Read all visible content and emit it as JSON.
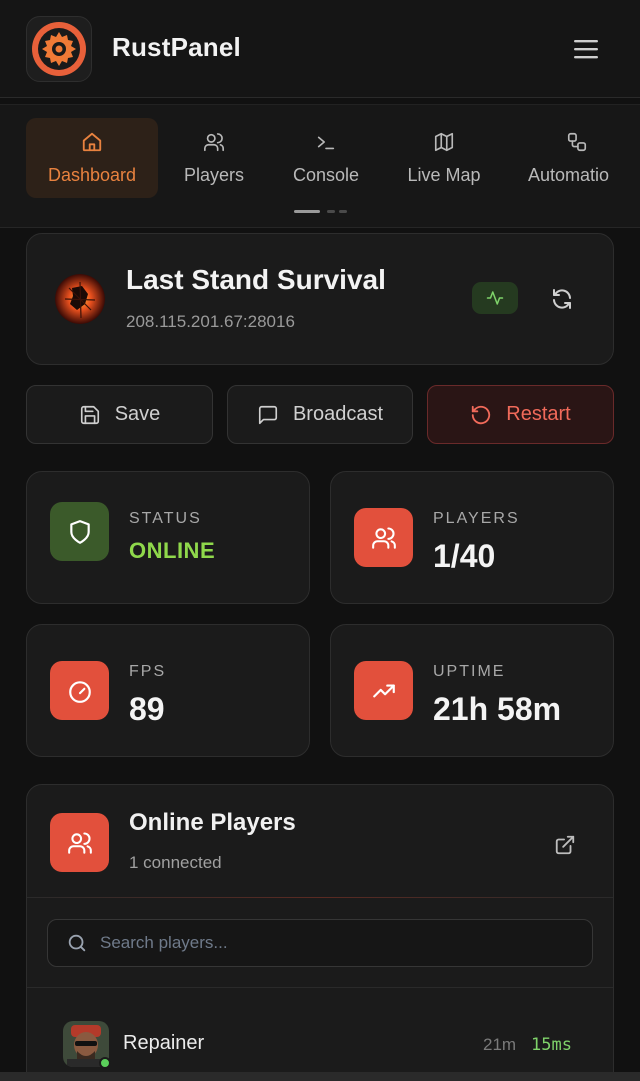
{
  "app": {
    "title": "RustPanel"
  },
  "nav": {
    "tabs": [
      {
        "label": "Dashboard",
        "icon": "home-icon",
        "active": true
      },
      {
        "label": "Players",
        "icon": "users-icon",
        "active": false
      },
      {
        "label": "Console",
        "icon": "terminal-icon",
        "active": false
      },
      {
        "label": "Live Map",
        "icon": "map-icon",
        "active": false
      },
      {
        "label": "Automatio",
        "icon": "workflow-icon",
        "active": false
      }
    ]
  },
  "server": {
    "name": "Last Stand Survival",
    "address": "208.115.201.67:28016"
  },
  "actions": {
    "save": "Save",
    "broadcast": "Broadcast",
    "restart": "Restart"
  },
  "stats": {
    "status": {
      "label": "STATUS",
      "value": "ONLINE"
    },
    "players": {
      "label": "PLAYERS",
      "value": "1/40"
    },
    "fps": {
      "label": "FPS",
      "value": "89"
    },
    "uptime": {
      "label": "UPTIME",
      "value": "21h 58m"
    }
  },
  "online_players": {
    "title": "Online Players",
    "subtitle": "1 connected",
    "search_placeholder": "Search players...",
    "rows": [
      {
        "name": "Repainer",
        "time": "21m",
        "ping": "15ms"
      }
    ]
  },
  "colors": {
    "accent": "#e8823f",
    "danger": "#e2503c",
    "online": "#8fd84b",
    "status_bg": "#3b5a2a"
  }
}
